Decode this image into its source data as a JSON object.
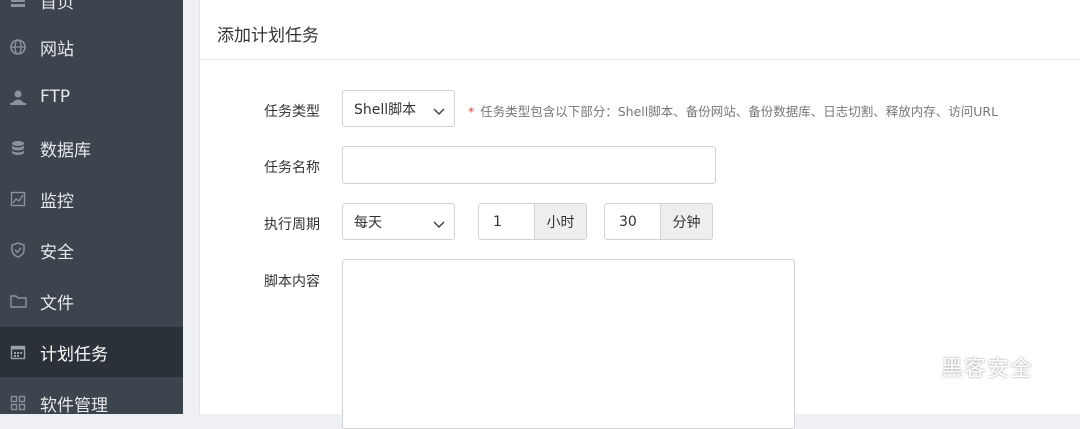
{
  "sidebar": {
    "items": [
      {
        "label": "首页",
        "icon": "home-icon",
        "active": false
      },
      {
        "label": "网站",
        "icon": "globe-icon",
        "active": false
      },
      {
        "label": "FTP",
        "icon": "ftp-user-icon",
        "active": false
      },
      {
        "label": "数据库",
        "icon": "database-icon",
        "active": false
      },
      {
        "label": "监控",
        "icon": "monitor-icon",
        "active": false
      },
      {
        "label": "安全",
        "icon": "shield-icon",
        "active": false
      },
      {
        "label": "文件",
        "icon": "folder-icon",
        "active": false
      },
      {
        "label": "计划任务",
        "icon": "calendar-icon",
        "active": true
      },
      {
        "label": "软件管理",
        "icon": "grid-icon",
        "active": false
      }
    ]
  },
  "panel": {
    "title": "添加计划任务"
  },
  "form": {
    "task_type": {
      "label": "任务类型",
      "value": "Shell脚本",
      "hint_star": "*",
      "hint": "任务类型包含以下部分：Shell脚本、备份网站、备份数据库、日志切割、释放内存、访问URL"
    },
    "task_name": {
      "label": "任务名称",
      "value": ""
    },
    "period": {
      "label": "执行周期",
      "frequency": "每天",
      "hour_value": "1",
      "hour_unit": "小时",
      "minute_value": "30",
      "minute_unit": "分钟"
    },
    "script": {
      "label": "脚本内容",
      "value": ""
    }
  },
  "watermark": {
    "text": "黑客安全",
    "icon": "wechat-icon"
  },
  "colors": {
    "sidebar_bg": "#3c444d",
    "sidebar_active_bg": "#2b3138",
    "required_star": "#e0403a"
  }
}
